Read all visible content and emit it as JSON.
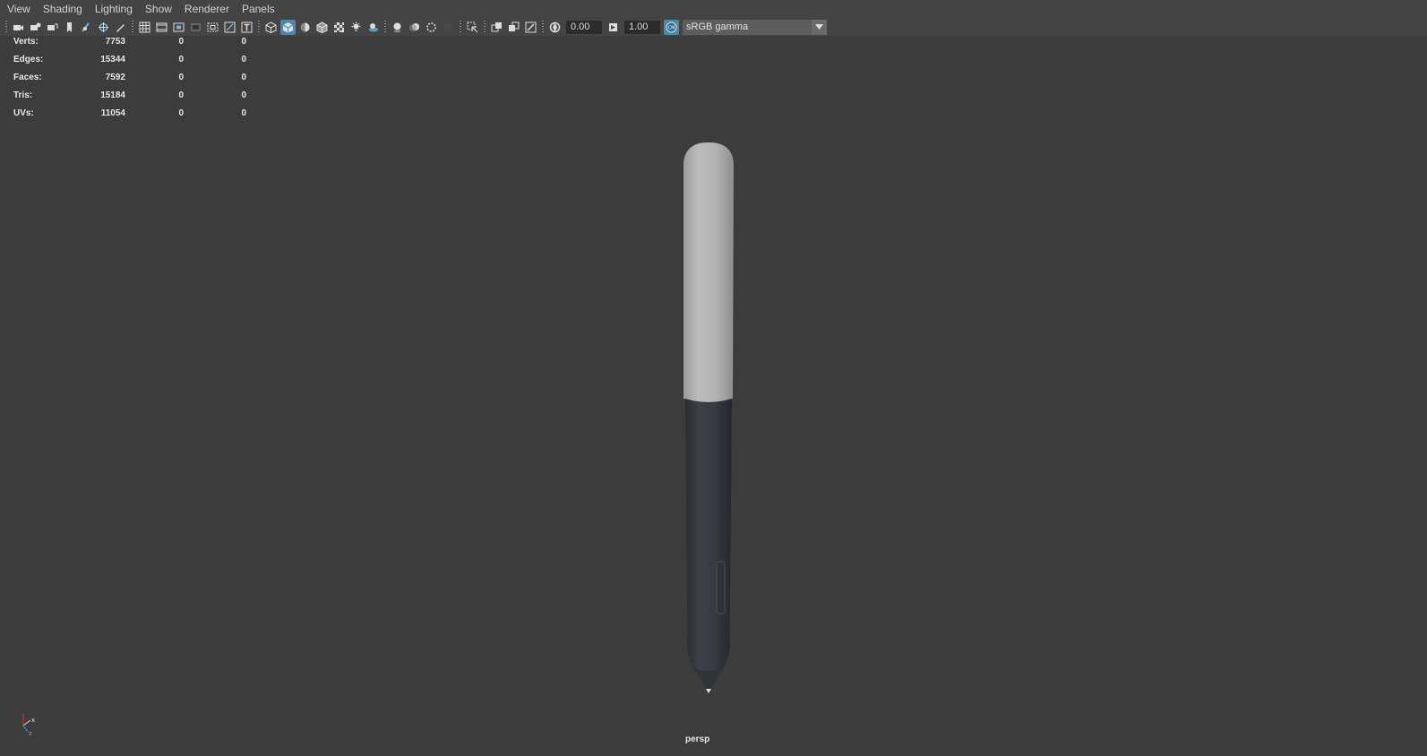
{
  "menubar": {
    "items": [
      "View",
      "Shading",
      "Lighting",
      "Show",
      "Renderer",
      "Panels"
    ]
  },
  "toolbar": {
    "exposure_value": "0.00",
    "gamma_value": "1.00",
    "color_space": "sRGB gamma",
    "accent_color": "#5285a6",
    "icons": [
      "select-camera-icon",
      "camera-attributes-icon",
      "bookmarks-icon",
      "image-plane-icon",
      "two-d-pan-zoom-icon",
      "grease-pencil-icon",
      "grid-icon",
      "film-gate-icon",
      "resolution-gate-icon",
      "gate-mask-icon",
      "field-chart-icon",
      "safe-action-icon",
      "safe-title-icon",
      "wireframe-icon",
      "smooth-shade-icon",
      "default-material-icon",
      "shaded-wireframe-icon",
      "textured-icon",
      "use-all-lights-icon",
      "shadows-icon",
      "screen-space-ao-icon",
      "motion-blur-icon",
      "anti-aliasing-icon",
      "depth-of-field-icon",
      "isolate-select-icon",
      "x-ray-icon",
      "x-ray-active-icon",
      "x-ray-joints-icon",
      "exposure-icon",
      "gamma-icon",
      "color-management-icon"
    ]
  },
  "hud": {
    "rows": [
      {
        "label": "Verts:",
        "v1": "7753",
        "v2": "0",
        "v3": "0"
      },
      {
        "label": "Edges:",
        "v1": "15344",
        "v2": "0",
        "v3": "0"
      },
      {
        "label": "Faces:",
        "v1": "7592",
        "v2": "0",
        "v3": "0"
      },
      {
        "label": "Tris:",
        "v1": "15184",
        "v2": "0",
        "v3": "0"
      },
      {
        "label": "UVs:",
        "v1": "11054",
        "v2": "0",
        "v3": "0"
      }
    ]
  },
  "viewport": {
    "camera_label": "persp",
    "background_color": "#3c3c3c",
    "axis_labels": {
      "x": "x",
      "z": "z"
    }
  }
}
